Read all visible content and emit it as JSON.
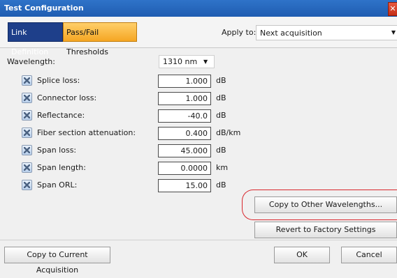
{
  "window": {
    "title": "Test Configuration",
    "close_glyph": "✕"
  },
  "tabs": [
    {
      "label": "Link Definition",
      "active": true,
      "color": "#1e3f8a"
    },
    {
      "label": "Pass/Fail Thresholds",
      "active": false,
      "color": "#f5a623"
    }
  ],
  "apply": {
    "label": "Apply to:",
    "value": "Next acquisition"
  },
  "wavelength": {
    "label": "Wavelength:",
    "value": "1310 nm"
  },
  "thresholds": [
    {
      "label": "Splice loss:",
      "value": "1.000",
      "unit": "dB",
      "checked": true
    },
    {
      "label": "Connector loss:",
      "value": "1.000",
      "unit": "dB",
      "checked": true
    },
    {
      "label": "Reflectance:",
      "value": "-40.0",
      "unit": "dB",
      "checked": true
    },
    {
      "label": "Fiber section attenuation:",
      "value": "0.400",
      "unit": "dB/km",
      "checked": true
    },
    {
      "label": "Span loss:",
      "value": "45.000",
      "unit": "dB",
      "checked": true
    },
    {
      "label": "Span length:",
      "value": "0.0000",
      "unit": "km",
      "checked": true
    },
    {
      "label": "Span ORL:",
      "value": "15.00",
      "unit": "dB",
      "checked": true
    }
  ],
  "buttons": {
    "copy_other": "Copy to Other Wavelengths...",
    "revert": "Revert to Factory Settings",
    "copy_current": "Copy to Current Acquisition",
    "ok": "OK",
    "cancel": "Cancel"
  },
  "colors": {
    "title_bar": "#1f5cb1",
    "highlight": "#d8262c"
  }
}
